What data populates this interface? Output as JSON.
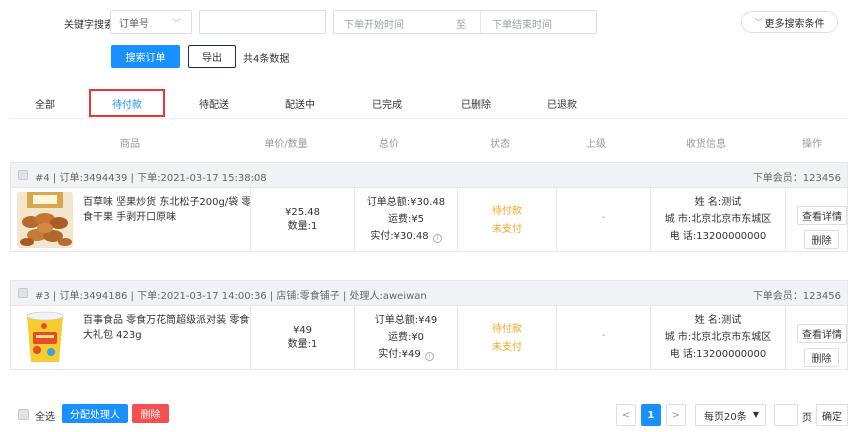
{
  "search": {
    "keyword_label": "关键字搜索:",
    "field_select": "订单号",
    "keyword_value": "",
    "start_placeholder": "下单开始时间",
    "range_sep": "至",
    "end_placeholder": "下单结束时间",
    "more_label": "更多搜索条件",
    "search_btn": "搜索订单",
    "export_btn": "导出",
    "total_text": "共4条数据"
  },
  "tabs": [
    {
      "label": "全部"
    },
    {
      "label": "待付款",
      "active": true
    },
    {
      "label": "待配送"
    },
    {
      "label": "配送中"
    },
    {
      "label": "已完成"
    },
    {
      "label": "已删除"
    },
    {
      "label": "已退款"
    }
  ],
  "columns": [
    "商品",
    "单价/数量",
    "总价",
    "状态",
    "上级",
    "收货信息",
    "操作"
  ],
  "orders": [
    {
      "head_info": "#4 | 订单:3494439 | 下单:2021-03-17 15:38:08",
      "member": "下单会员：123456",
      "product_line1": "百草味 坚果炒货 东北松子200g/袋 零",
      "product_line2": "食干果 手剥开口原味",
      "price": "¥25.48",
      "qty": "数量:1",
      "total": "订单总额:¥30.48",
      "freight": "运费:¥5",
      "paid": "实付:¥30.48",
      "status1": "待付款",
      "status2": "未支付",
      "superior": "-",
      "recv_name": "姓 名:测试",
      "recv_city": "城 市:北京北京市东城区",
      "recv_phone": "电 话:13200000000",
      "op_detail": "查看详情",
      "op_delete": "删除"
    },
    {
      "head_info": "#3 | 订单:3494186 | 下单:2021-03-17 14:00:36 | 店铺:零食铺子 | 处理人:aweiwan",
      "member": "下单会员：123456",
      "product_line1": "百事食品 零食万花筒超级派对装 零食",
      "product_line2": "大礼包 423g",
      "price": "¥49",
      "qty": "数量:1",
      "total": "订单总额:¥49",
      "freight": "运费:¥0",
      "paid": "实付:¥49",
      "status1": "待付款",
      "status2": "未支付",
      "superior": "-",
      "recv_name": "姓 名:测试",
      "recv_city": "城 市:北京北京市东城区",
      "recv_phone": "电 话:13200000000",
      "op_detail": "查看详情",
      "op_delete": "删除"
    }
  ],
  "footer": {
    "select_all": "全选",
    "assign_btn": "分配处理人",
    "delete_btn": "删除",
    "prev": "<",
    "page": "1",
    "next": ">",
    "per_page": "每页20条",
    "goto_value": "",
    "page_unit": "页",
    "confirm": "确定"
  },
  "colors": {
    "primary": "#1890ff",
    "danger": "#f5504f",
    "status": "#f5a623",
    "highlight_box": "#e53935"
  }
}
